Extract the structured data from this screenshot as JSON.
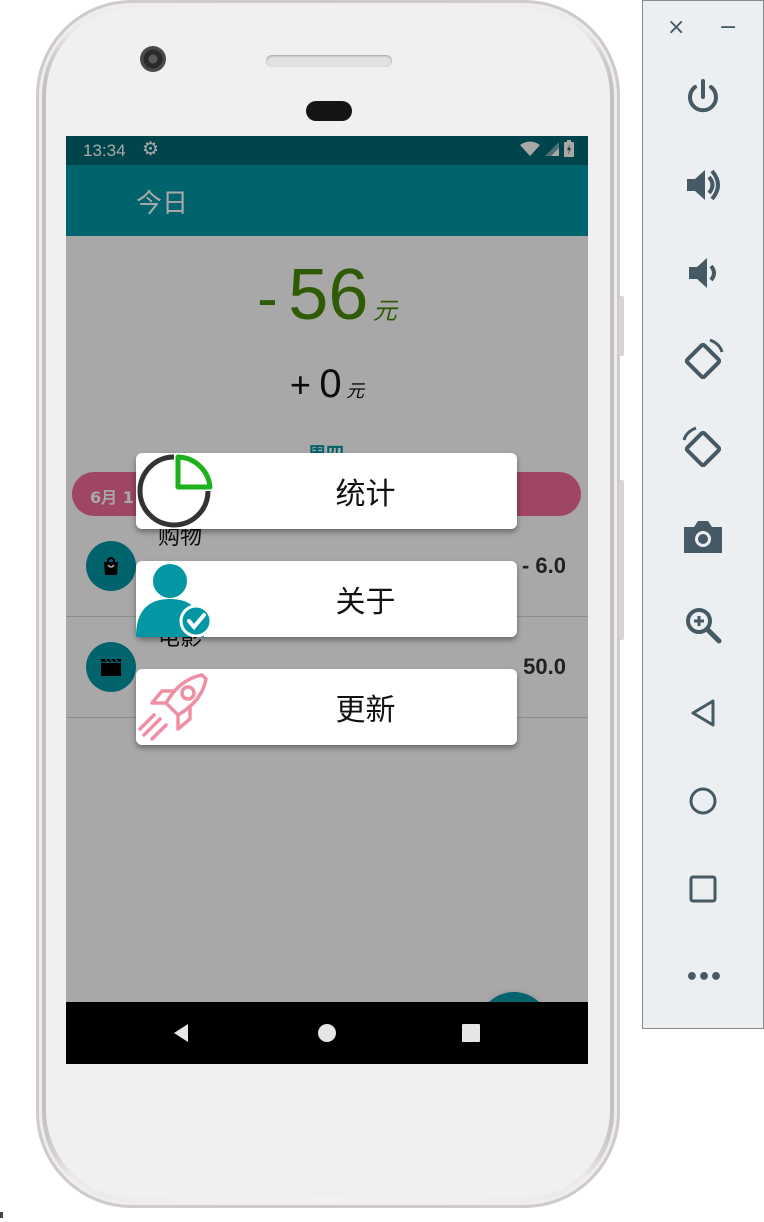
{
  "status_bar": {
    "time": "13:34"
  },
  "app_bar": {
    "title": "今日"
  },
  "summary": {
    "expense_sign": "-",
    "expense_amount": "56",
    "income_sign": "+",
    "income_amount": "0",
    "unit": "元"
  },
  "day_section": {
    "weekday": "周四",
    "date": "6月 1"
  },
  "transactions": [
    {
      "category": "购物",
      "amount": "- 6.0",
      "icon": "shopping-bag-icon"
    },
    {
      "category": "电影",
      "amount": "50.0",
      "icon": "movie-clapper-icon"
    }
  ],
  "fab": {
    "label": "+"
  },
  "popup_menu": [
    {
      "label": "统计",
      "icon": "pie-chart-icon"
    },
    {
      "label": "关于",
      "icon": "user-verified-icon"
    },
    {
      "label": "更新",
      "icon": "rocket-icon"
    }
  ],
  "emulator_panel": {
    "close": "×",
    "minimize": "−",
    "tools": [
      "power-icon",
      "volume-up-icon",
      "volume-down-icon",
      "rotate-left-icon",
      "rotate-right-icon",
      "camera-icon",
      "zoom-icon",
      "back-icon",
      "home-icon",
      "overview-icon",
      "more-icon"
    ],
    "more_label": "•••"
  },
  "colors": {
    "primary": "#0397a4",
    "status_bar": "#016972",
    "expense_green": "#4a8a0a",
    "date_pill": "#f26b95",
    "overlay": "rgba(0,0,0,0.34)"
  }
}
